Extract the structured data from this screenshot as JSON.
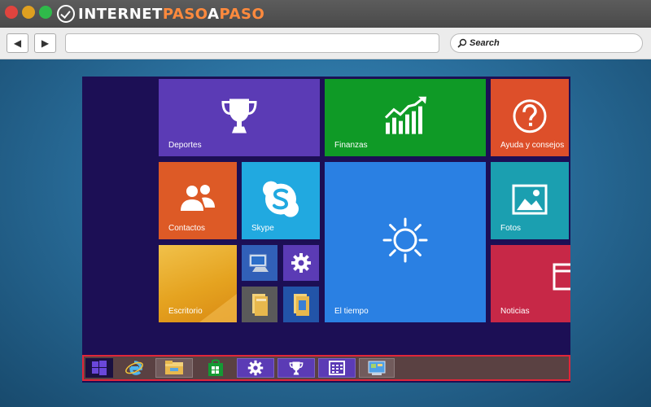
{
  "brand": {
    "name_part1": "INTERNET",
    "name_part2": "PASO",
    "name_part3": "A",
    "name_part4": "PASO"
  },
  "browser": {
    "back_glyph": "◀",
    "forward_glyph": "▶",
    "url_value": "",
    "search_placeholder": "Search"
  },
  "tiles": {
    "deportes": "Deportes",
    "finanzas": "Finanzas",
    "ayuda": "Ayuda y consejos",
    "contactos": "Contactos",
    "skype": "Skype",
    "tiempo": "El tiempo",
    "fotos": "Fotos",
    "escritorio": "Escritorio",
    "noticias": "Noticias"
  },
  "colors": {
    "deportes": "#5b3bb5",
    "finanzas": "#0f9a26",
    "ayuda": "#dd4f2a",
    "contactos": "#dd5a26",
    "skype": "#21a9e0",
    "tiempo": "#2a80e3",
    "fotos": "#1b9fb0",
    "escritorio": "#e5a320",
    "noticias": "#c72847",
    "screen_bg": "#1c0f55",
    "taskbar_border": "#e0263a"
  },
  "icons": {
    "deportes": "trophy-icon",
    "finanzas": "finance-chart-icon",
    "ayuda": "help-question-icon",
    "contactos": "people-icon",
    "skype": "skype-icon",
    "tiempo": "sun-icon",
    "fotos": "photo-icon",
    "noticias": "news-icon",
    "computer": "computer-icon",
    "settings": "gear-icon",
    "folder": "folder-icon",
    "library": "library-icon"
  },
  "taskbar": [
    "windows-logo-icon",
    "internet-explorer-icon",
    "file-explorer-icon",
    "store-icon",
    "settings-icon",
    "trophy-icon",
    "calendar-icon",
    "control-panel-icon"
  ]
}
